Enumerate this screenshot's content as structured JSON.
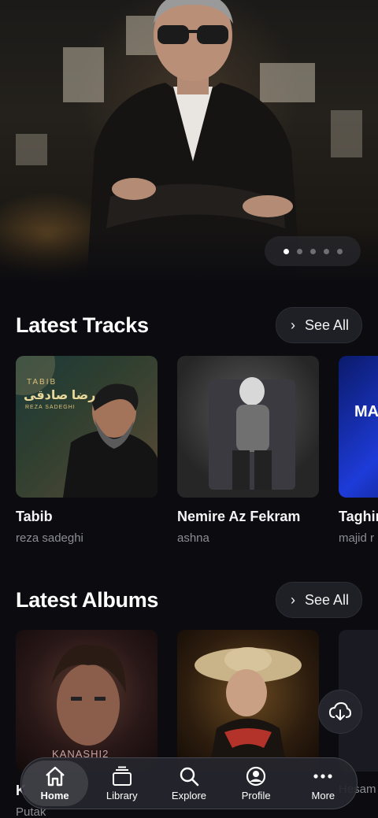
{
  "carousel": {
    "slides": 5,
    "active_index": 0
  },
  "latest_tracks": {
    "title": "Latest Tracks",
    "see_all_label": "See All",
    "items": [
      {
        "title": "Tabib",
        "artist": "reza sadeghi",
        "cover_text_fa": "رضا صادقی",
        "cover_text_en": "TABIB",
        "cover_text_sub": "REZA SADEGHI"
      },
      {
        "title": "Nemire Az Fekram",
        "artist": "ashna"
      },
      {
        "title": "Taghir",
        "artist": "majid r",
        "cover_text": "MAJ RAZA"
      }
    ]
  },
  "latest_albums": {
    "title": "Latest Albums",
    "see_all_label": "See All",
    "items": [
      {
        "title": "K",
        "artist": "Putak",
        "cover_text": "KANASHI2"
      },
      {
        "title": "",
        "artist": ""
      },
      {
        "title": "",
        "artist": "Hesam"
      }
    ]
  },
  "download_icon": "cloud-download-icon",
  "nav": {
    "items": [
      {
        "label": "Home",
        "icon": "home-icon",
        "active": true
      },
      {
        "label": "Library",
        "icon": "library-icon",
        "active": false
      },
      {
        "label": "Explore",
        "icon": "search-icon",
        "active": false
      },
      {
        "label": "Profile",
        "icon": "profile-icon",
        "active": false
      },
      {
        "label": "More",
        "icon": "more-icon",
        "active": false
      }
    ]
  }
}
